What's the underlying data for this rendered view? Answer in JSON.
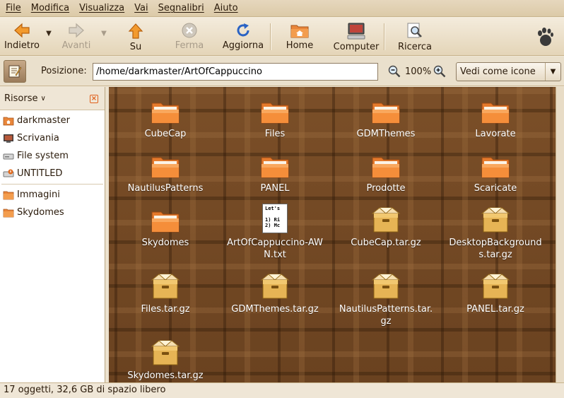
{
  "menubar": {
    "items": [
      {
        "label": "File"
      },
      {
        "label": "Modifica"
      },
      {
        "label": "Visualizza"
      },
      {
        "label": "Vai"
      },
      {
        "label": "Segnalibri"
      },
      {
        "label": "Aiuto"
      }
    ]
  },
  "toolbar": {
    "back": {
      "label": "Indietro",
      "icon": "arrow-left-icon"
    },
    "forward": {
      "label": "Avanti",
      "icon": "arrow-right-icon",
      "disabled": true
    },
    "up": {
      "label": "Su",
      "icon": "arrow-up-icon"
    },
    "stop": {
      "label": "Ferma",
      "icon": "stop-icon",
      "disabled": true
    },
    "reload": {
      "label": "Aggiorna",
      "icon": "reload-icon"
    },
    "home": {
      "label": "Home",
      "icon": "home-folder-icon"
    },
    "computer": {
      "label": "Computer",
      "icon": "computer-icon"
    },
    "search": {
      "label": "Ricerca",
      "icon": "search-icon"
    },
    "brand_icon": "gnome-foot-icon"
  },
  "location": {
    "label": "Posizione:",
    "path": "/home/darkmaster/ArtOfCappuccino",
    "zoom": "100%",
    "view_mode": "Vedi come icone"
  },
  "sidebar": {
    "title": "Risorse",
    "places": [
      {
        "label": "darkmaster",
        "icon": "home-icon"
      },
      {
        "label": "Scrivania",
        "icon": "desktop-icon"
      },
      {
        "label": "File system",
        "icon": "drive-icon"
      },
      {
        "label": "UNTITLED",
        "icon": "removable-drive-icon"
      }
    ],
    "bookmarks": [
      {
        "label": "Immagini",
        "icon": "folder-icon"
      },
      {
        "label": "Skydomes",
        "icon": "folder-icon"
      }
    ]
  },
  "files": [
    {
      "name": "CubeCap",
      "kind": "folder"
    },
    {
      "name": "Files",
      "kind": "folder"
    },
    {
      "name": "GDMThemes",
      "kind": "folder"
    },
    {
      "name": "Lavorate",
      "kind": "folder"
    },
    {
      "name": "NautilusPatterns",
      "kind": "folder"
    },
    {
      "name": "PANEL",
      "kind": "folder"
    },
    {
      "name": "Prodotte",
      "kind": "folder"
    },
    {
      "name": "Scaricate",
      "kind": "folder"
    },
    {
      "name": "Skydomes",
      "kind": "folder"
    },
    {
      "name": "ArtOfCappuccino-AWN.txt",
      "kind": "text",
      "preview": [
        "Let's",
        "1) Ri",
        "2) Mc"
      ]
    },
    {
      "name": "CubeCap.tar.gz",
      "kind": "archive"
    },
    {
      "name": "DesktopBackgrounds.tar.gz",
      "kind": "archive"
    },
    {
      "name": "Files.tar.gz",
      "kind": "archive"
    },
    {
      "name": "GDMThemes.tar.gz",
      "kind": "archive"
    },
    {
      "name": "NautilusPatterns.tar.gz",
      "kind": "archive"
    },
    {
      "name": "PANEL.tar.gz",
      "kind": "archive"
    },
    {
      "name": "Skydomes.tar.gz",
      "kind": "archive"
    }
  ],
  "status": {
    "text": "17 oggetti, 32,6 GB di spazio libero"
  }
}
